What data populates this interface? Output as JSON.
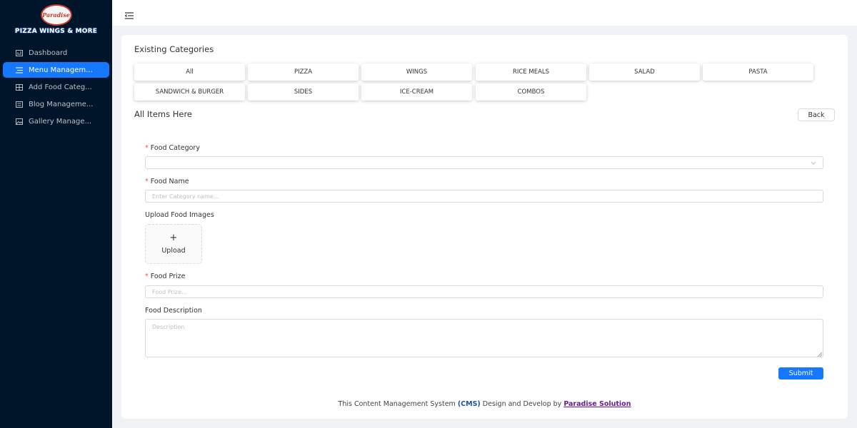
{
  "sidebar": {
    "logo_badge": "Paradise",
    "logo_text": "PIZZA WINGS & MORE",
    "items": [
      {
        "label": "Dashboard",
        "icon": "dashboard-icon",
        "active": false
      },
      {
        "label": "Menu Managem...",
        "icon": "menu-list-icon",
        "active": true
      },
      {
        "label": "Add Food Categ...",
        "icon": "table-icon",
        "active": false
      },
      {
        "label": "Blog Manageme...",
        "icon": "blog-icon",
        "active": false
      },
      {
        "label": "Gallery Manage...",
        "icon": "gallery-icon",
        "active": false
      }
    ]
  },
  "header": {
    "fold_icon": "menu-fold-icon"
  },
  "main": {
    "existing_title": "Existing Categories",
    "categories": [
      "All",
      "PIZZA",
      "WINGS",
      "RICE MEALS",
      "SALAD",
      "PASTA",
      "SANDWICH & BURGER",
      "SIDES",
      "ICE-CREAM",
      "COMBOS"
    ],
    "all_items_title": "All Items Here",
    "back_label": "Back"
  },
  "form": {
    "category_label": "Food Category",
    "category_value": "",
    "name_label": "Food Name",
    "name_placeholder": "Enter Category name...",
    "images_label": "Upload Food Images",
    "upload_plus": "+",
    "upload_label": "Upload",
    "prize_label": "Food Prize",
    "prize_placeholder": "Food Prize...",
    "description_label": "Food Description",
    "description_placeholder": "Description",
    "submit_label": "Submit",
    "required_mark": "*"
  },
  "footer": {
    "text_before": "This Content Management System ",
    "cms": "(CMS)",
    "text_middle": " Design and Develop by ",
    "link": "Paradise Solution"
  },
  "colors": {
    "sidebar_bg": "#001529",
    "accent": "#1677ff",
    "required": "#ff4d4f",
    "footer_link": "#6a1b9a"
  }
}
